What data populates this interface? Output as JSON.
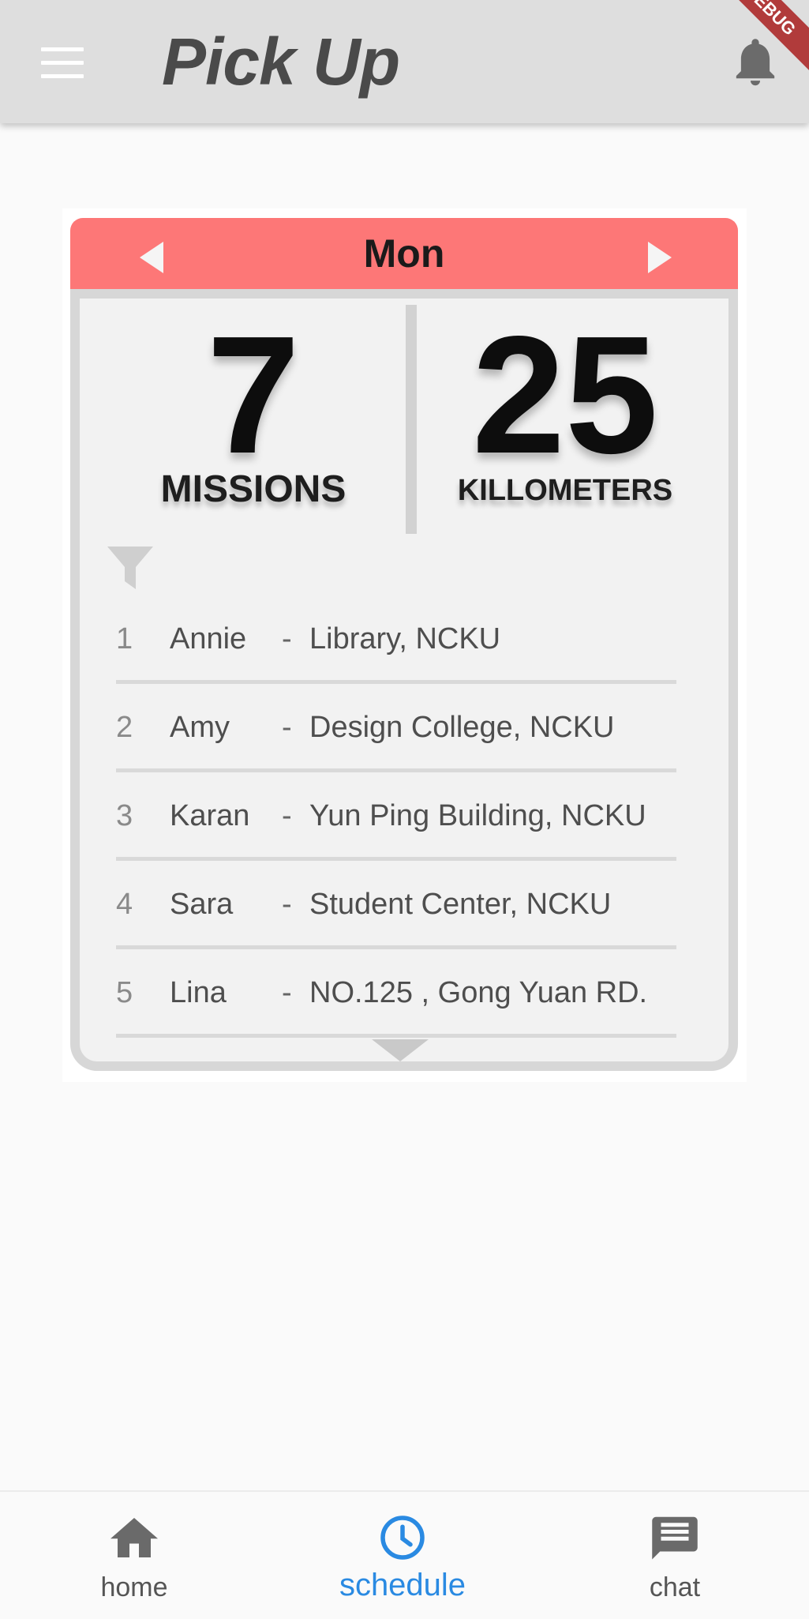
{
  "app_bar": {
    "title": "Pick Up",
    "debug_banner": "DEBUG",
    "menu_icon": "hamburger-menu-icon",
    "notification_icon": "bell-icon"
  },
  "card": {
    "day": "Mon",
    "prev_icon": "arrow-left-icon",
    "next_icon": "arrow-right-icon",
    "stats": {
      "missions_value": "7",
      "missions_label": "MISSIONS",
      "kilometers_value": "25",
      "kilometers_label": "KILLOMETERS"
    },
    "filter_icon": "filter-icon",
    "missions": [
      {
        "index": "1",
        "name": "Annie",
        "separator": "-",
        "place": "Library, NCKU"
      },
      {
        "index": "2",
        "name": "Amy",
        "separator": "-",
        "place": "Design College, NCKU"
      },
      {
        "index": "3",
        "name": "Karan",
        "separator": "-",
        "place": "Yun Ping Building, NCKU"
      },
      {
        "index": "4",
        "name": "Sara",
        "separator": "-",
        "place": "Student Center, NCKU"
      },
      {
        "index": "5",
        "name": "Lina",
        "separator": "-",
        "place": "NO.125 ,  Gong Yuan RD."
      }
    ],
    "more_icon": "chevron-down-icon"
  },
  "bottom_nav": {
    "items": [
      {
        "label": "home",
        "icon": "home-icon"
      },
      {
        "label": "schedule",
        "icon": "clock-icon",
        "active": true
      },
      {
        "label": "chat",
        "icon": "chat-icon"
      }
    ]
  },
  "colors": {
    "header_accent": "#fd7777",
    "active_nav": "#2a8ae2",
    "app_bar": "#dedede"
  }
}
